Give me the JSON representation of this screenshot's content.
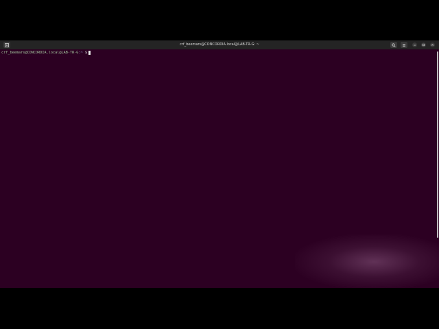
{
  "window": {
    "title": "crf_beemars@CONCORDIA.local@LAB-TR-G: ~"
  },
  "icons": {
    "new_tab": "new-tab-icon",
    "search": "search-icon",
    "menu": "hamburger-menu-icon",
    "minimize": "minimize-icon",
    "maximize": "maximize-icon",
    "close": "close-icon"
  },
  "terminal": {
    "prompt_user_host": "crf_beemars@CONCORDIA.local@LAB-TR-G",
    "prompt_path": ":~",
    "prompt_symbol": "$"
  },
  "colors": {
    "terminal_background": "#2c0022",
    "titlebar_background": "#242424",
    "prompt_user_color": "#a6c7a0",
    "prompt_path_color": "#9bb0d8"
  }
}
